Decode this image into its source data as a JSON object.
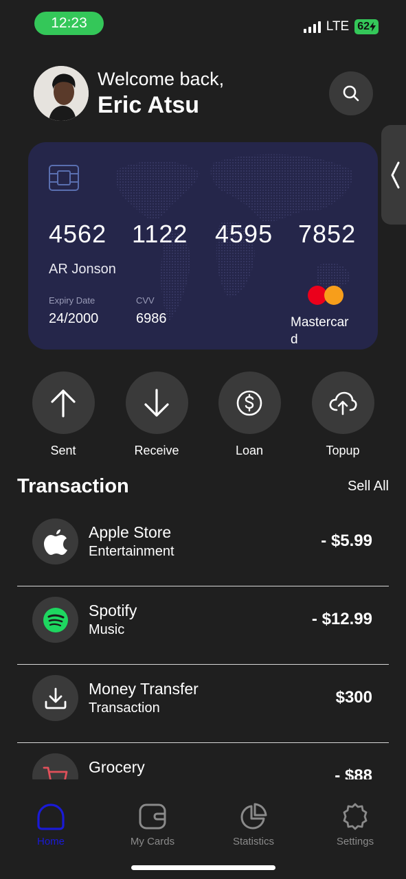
{
  "status": {
    "time": "12:23",
    "network": "LTE",
    "battery": "62"
  },
  "header": {
    "welcome": "Welcome back,",
    "name": "Eric Atsu"
  },
  "card": {
    "number_groups": [
      "4562",
      "1122",
      "4595",
      "7852"
    ],
    "holder": "AR Jonson",
    "expiry_label": "Expiry Date",
    "expiry": "24/2000",
    "cvv_label": "CVV",
    "cvv": "6986",
    "brand": "Mastercard"
  },
  "actions": [
    {
      "label": "Sent",
      "icon": "arrow-up-icon"
    },
    {
      "label": "Receive",
      "icon": "arrow-down-icon"
    },
    {
      "label": "Loan",
      "icon": "dollar-circle-icon"
    },
    {
      "label": "Topup",
      "icon": "cloud-upload-icon"
    }
  ],
  "transactions": {
    "title": "Transaction",
    "see_all": "Sell All",
    "items": [
      {
        "name": "Apple Store",
        "category": "Entertainment",
        "amount": "- $5.99",
        "icon": "apple-icon"
      },
      {
        "name": "Spotify",
        "category": "Music",
        "amount": "- $12.99",
        "icon": "spotify-icon"
      },
      {
        "name": "Money Transfer",
        "category": "Transaction",
        "amount": "$300",
        "icon": "download-icon"
      },
      {
        "name": "Grocery",
        "category": "",
        "amount": "- $88",
        "icon": "cart-icon"
      }
    ]
  },
  "tabs": [
    {
      "label": "Home",
      "icon": "home-icon",
      "active": true
    },
    {
      "label": "My Cards",
      "icon": "wallet-icon",
      "active": false
    },
    {
      "label": "Statistics",
      "icon": "chart-icon",
      "active": false
    },
    {
      "label": "Settings",
      "icon": "gear-icon",
      "active": false
    }
  ],
  "colors": {
    "background": "#1f1f1f",
    "card": "#25264a",
    "status_green": "#34c759",
    "active_tab": "#1a1ad6",
    "circle": "#3a3a3a"
  }
}
